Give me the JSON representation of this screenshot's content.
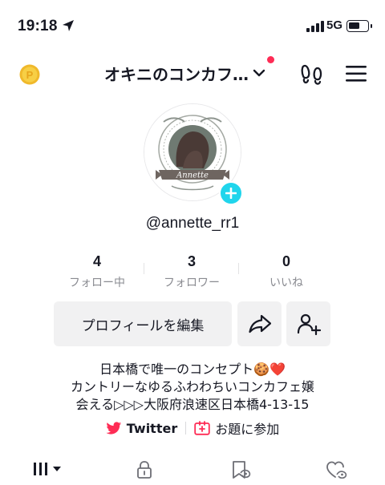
{
  "status_bar": {
    "time": "19:18",
    "network": "5G"
  },
  "header": {
    "account_name": "オキニのコンカフ…",
    "icons": [
      "coin-icon",
      "chevron-down-icon",
      "footprint-icon",
      "menu-icon"
    ],
    "notification_dot_color": "#fe2c55"
  },
  "profile": {
    "avatar_text": "Annette",
    "username": "@annette_rr1",
    "stats": [
      {
        "value": "4",
        "label": "フォロー中"
      },
      {
        "value": "3",
        "label": "フォロワー"
      },
      {
        "value": "0",
        "label": "いいね"
      }
    ]
  },
  "actions": {
    "edit_label": "プロフィールを編集"
  },
  "bio": {
    "line1": "日本橋で唯一のコンセプト🍪❤️",
    "line2": "カントリーなゆるふわわちいコンカフェ嬢",
    "line3": "会える▷▷▷大阪府浪速区日本橋4-13-15"
  },
  "links": {
    "twitter": "Twitter",
    "topic": "お題に参加"
  },
  "tabs": [
    "videos-grid-icon",
    "lock-icon",
    "saved-icon",
    "liked-icon"
  ],
  "colors": {
    "accent": "#fe2c55",
    "plus": "#20d5ec",
    "button_bg": "#f1f1f2",
    "muted": "#8a8b91"
  }
}
